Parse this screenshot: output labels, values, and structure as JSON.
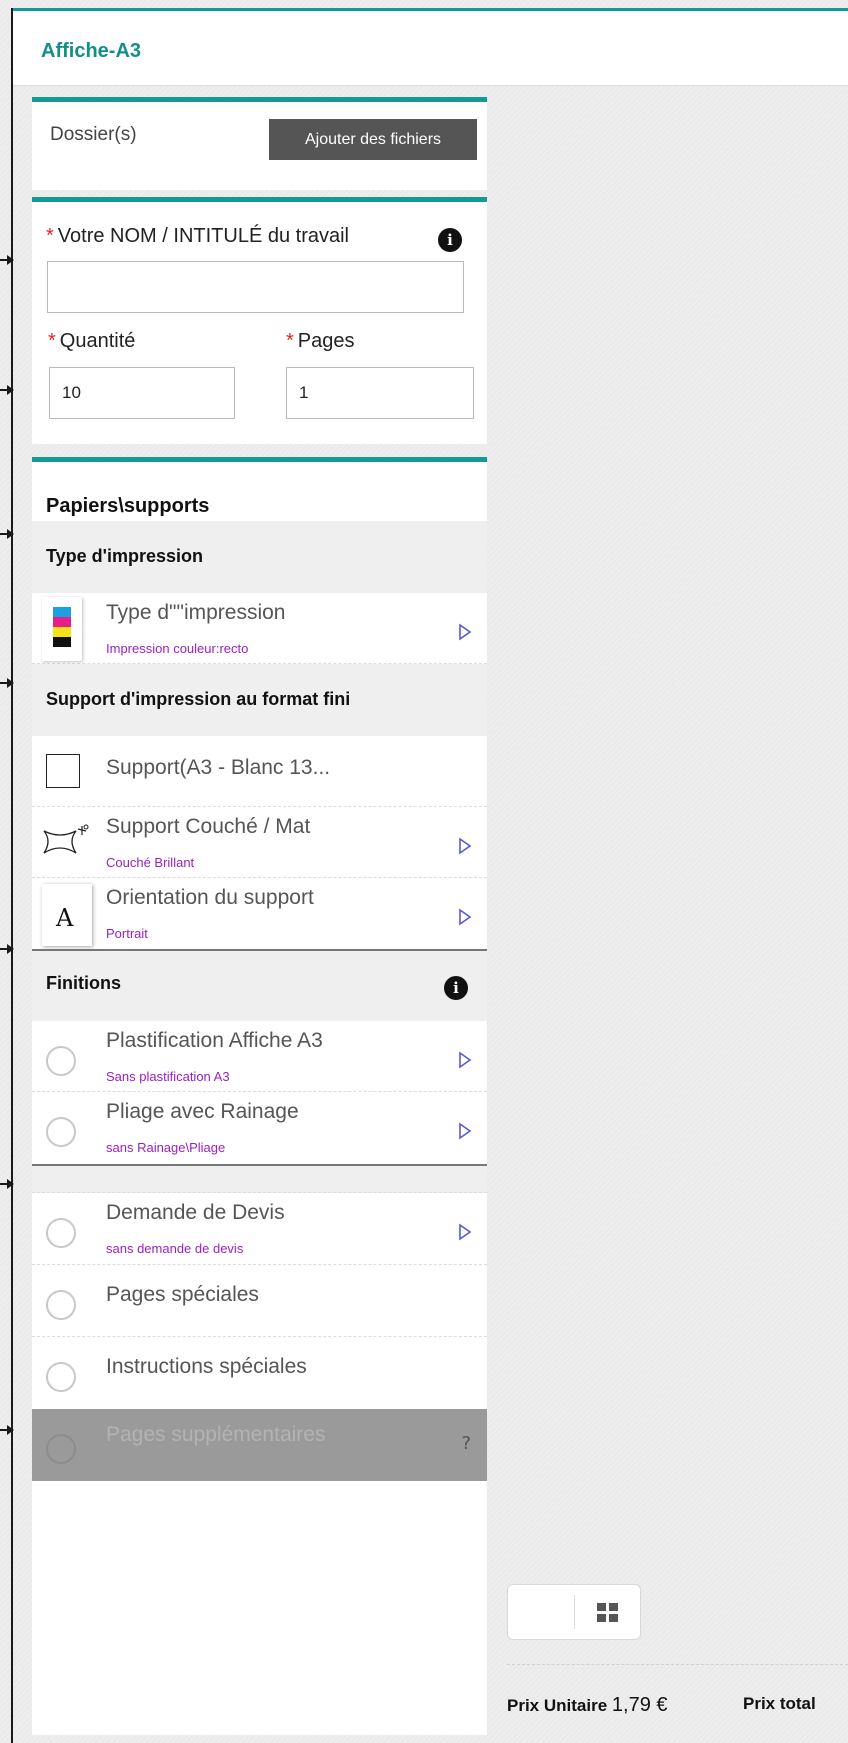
{
  "header": {
    "title": "Affiche-A3"
  },
  "files": {
    "label": "Dossier(s)",
    "add_button": "Ajouter des fichiers"
  },
  "job": {
    "name_label": "Votre NOM / INTITULÉ du travail",
    "name_value": "",
    "quantity_label": "Quantité",
    "quantity_value": "10",
    "pages_label": "Pages",
    "pages_value": "1",
    "required_mark": "*",
    "info_glyph": "i"
  },
  "options": {
    "title": "Papiers\\supports",
    "groups": {
      "print_type": {
        "label": "Type d'impression",
        "items": [
          {
            "title": "Type d\"\"impression",
            "subtitle": "Impression couleur:recto",
            "icon": "cmyk-icon"
          }
        ]
      },
      "support": {
        "label": "Support d'impression au format fini",
        "items": [
          {
            "title": "Support(A3 - Blanc 13...",
            "subtitle": "",
            "icon": "square-icon"
          },
          {
            "title": "Support Couché / Mat",
            "subtitle": "Couché Brillant",
            "icon": "sparkle-icon"
          },
          {
            "title": "Orientation du support",
            "subtitle": "Portrait",
            "icon": "letter-a-icon",
            "icon_glyph": "A"
          }
        ]
      },
      "finishes": {
        "label": "Finitions",
        "items": [
          {
            "title": "Plastification Affiche A3",
            "subtitle": "Sans plastification A3"
          },
          {
            "title": "Pliage avec Rainage",
            "subtitle": "sans Rainage\\Pliage"
          }
        ]
      },
      "extras": {
        "items": [
          {
            "title": "Demande de Devis",
            "subtitle": "sans demande de devis"
          },
          {
            "title": "Pages spéciales",
            "subtitle": ""
          },
          {
            "title": "Instructions spéciales",
            "subtitle": ""
          },
          {
            "title": "Pages supplémentaires",
            "subtitle": "",
            "disabled": true,
            "help_glyph": "?"
          }
        ]
      }
    }
  },
  "pricing": {
    "unit_label": "Prix Unitaire",
    "unit_value": "1,79 €",
    "total_label": "Prix total"
  },
  "colors": {
    "accent": "#139a94",
    "subtitle": "#9b1fc2",
    "required": "#e02424"
  }
}
